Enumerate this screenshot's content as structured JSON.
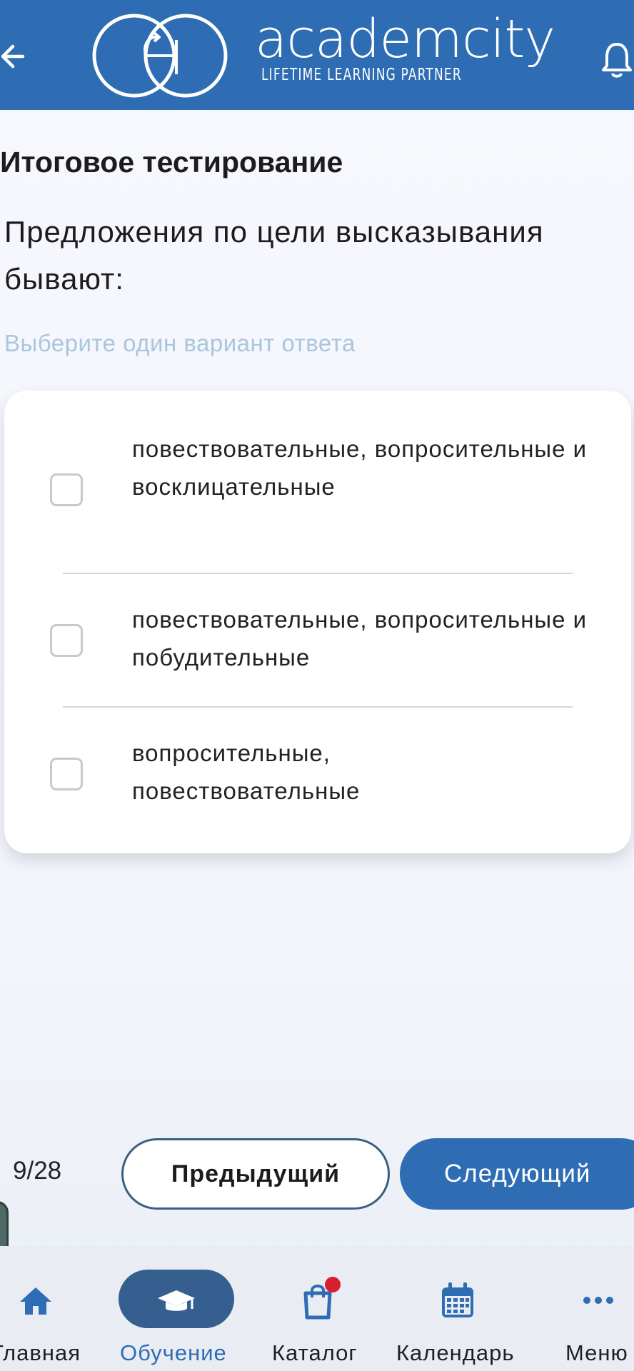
{
  "header": {
    "back_icon": "arrow-left-icon",
    "brand_name": "academcity",
    "brand_tagline": "LIFETIME LEARNING PARTNER",
    "notification_icon": "bell-icon",
    "background_color": "#2e6db4"
  },
  "test": {
    "title": "Итоговое тестирование",
    "question": "Предложения по цели высказывания бывают:",
    "hint": "Выберите один вариант ответа",
    "options": [
      {
        "text": "повествовательные, вопросительные и восклицательные",
        "checked": false
      },
      {
        "text": "повествовательные, вопросительные и побудительные",
        "checked": false
      },
      {
        "text": "вопросительные, повествовательные",
        "checked": false
      }
    ]
  },
  "pager": {
    "counter": "9/28",
    "prev_label": "Предыдущий",
    "next_label": "Следующий"
  },
  "nav": {
    "items": [
      {
        "label": "Главная",
        "icon": "home-icon"
      },
      {
        "label": "Обучение",
        "icon": "graduation-cap-icon",
        "active": true
      },
      {
        "label": "Каталог",
        "icon": "shopping-bag-icon",
        "badge": true
      },
      {
        "label": "Календарь",
        "icon": "calendar-icon"
      },
      {
        "label": "Меню",
        "icon": "more-dots-icon"
      }
    ]
  },
  "colors": {
    "accent": "#2e6db4",
    "active_pill": "#345f8f",
    "badge": "#d8202c",
    "hint": "#a9c6dd"
  }
}
